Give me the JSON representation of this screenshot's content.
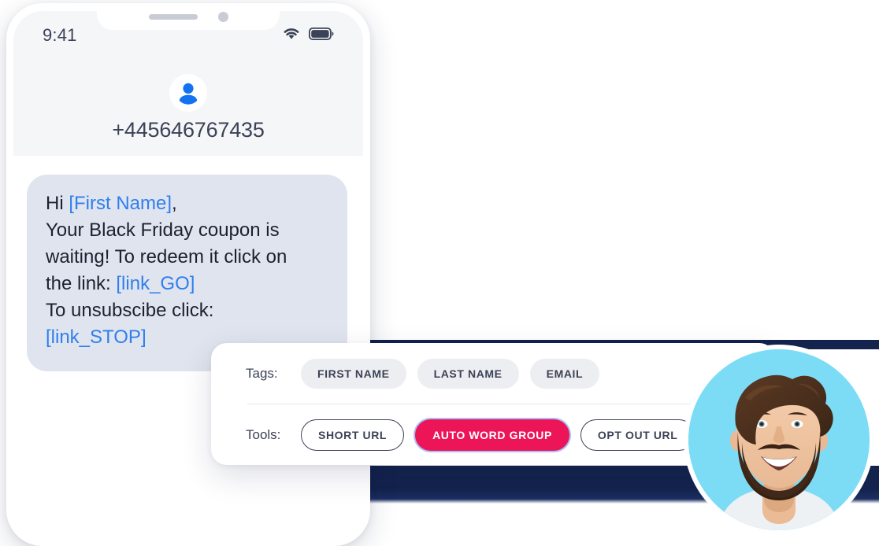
{
  "phone": {
    "status_bar": {
      "time": "9:41",
      "wifi_icon": "wifi-icon",
      "battery_icon": "battery-full-icon"
    },
    "notch": {
      "speaker_icon": "speaker-grille-icon",
      "camera_icon": "front-camera-icon"
    },
    "contact": {
      "avatar_icon": "person-avatar-icon",
      "number": "+445646767435"
    },
    "message": {
      "lines": [
        {
          "parts": [
            {
              "text": "Hi ",
              "token": false
            },
            {
              "text": "[First Name]",
              "token": true
            },
            {
              "text": ",",
              "token": false
            }
          ]
        },
        {
          "parts": [
            {
              "text": "Your Black Friday coupon is",
              "token": false
            }
          ]
        },
        {
          "parts": [
            {
              "text": "waiting! To redeem it click on",
              "token": false
            }
          ]
        },
        {
          "parts": [
            {
              "text": "the link: ",
              "token": false
            },
            {
              "text": "[link_GO]",
              "token": true
            }
          ]
        },
        {
          "parts": [
            {
              "text": "To unsubscibe click:",
              "token": false
            }
          ]
        },
        {
          "parts": [
            {
              "text": "[link_STOP]",
              "token": true
            }
          ]
        }
      ],
      "bubble_color": "#dfe4ee",
      "token_color": "#2f7fed"
    }
  },
  "panel": {
    "tags_label": "Tags:",
    "tags": [
      {
        "label": "FIRST NAME",
        "style": "tag"
      },
      {
        "label": "LAST NAME",
        "style": "tag"
      },
      {
        "label": "EMAIL",
        "style": "tag"
      }
    ],
    "tools_label": "Tools:",
    "tools": [
      {
        "label": "SHORT URL",
        "style": "outline"
      },
      {
        "label": "AUTO WORD GROUP",
        "style": "filled"
      },
      {
        "label": "OPT OUT URL",
        "style": "outline"
      }
    ],
    "accent_color": "#ec1557",
    "tag_bg_color": "#eceef1"
  },
  "avatar_photo": {
    "name": "smiling-man-photo",
    "background_color": "#7ddcf5"
  },
  "backdrop": {
    "navy_color": "#13234d"
  }
}
